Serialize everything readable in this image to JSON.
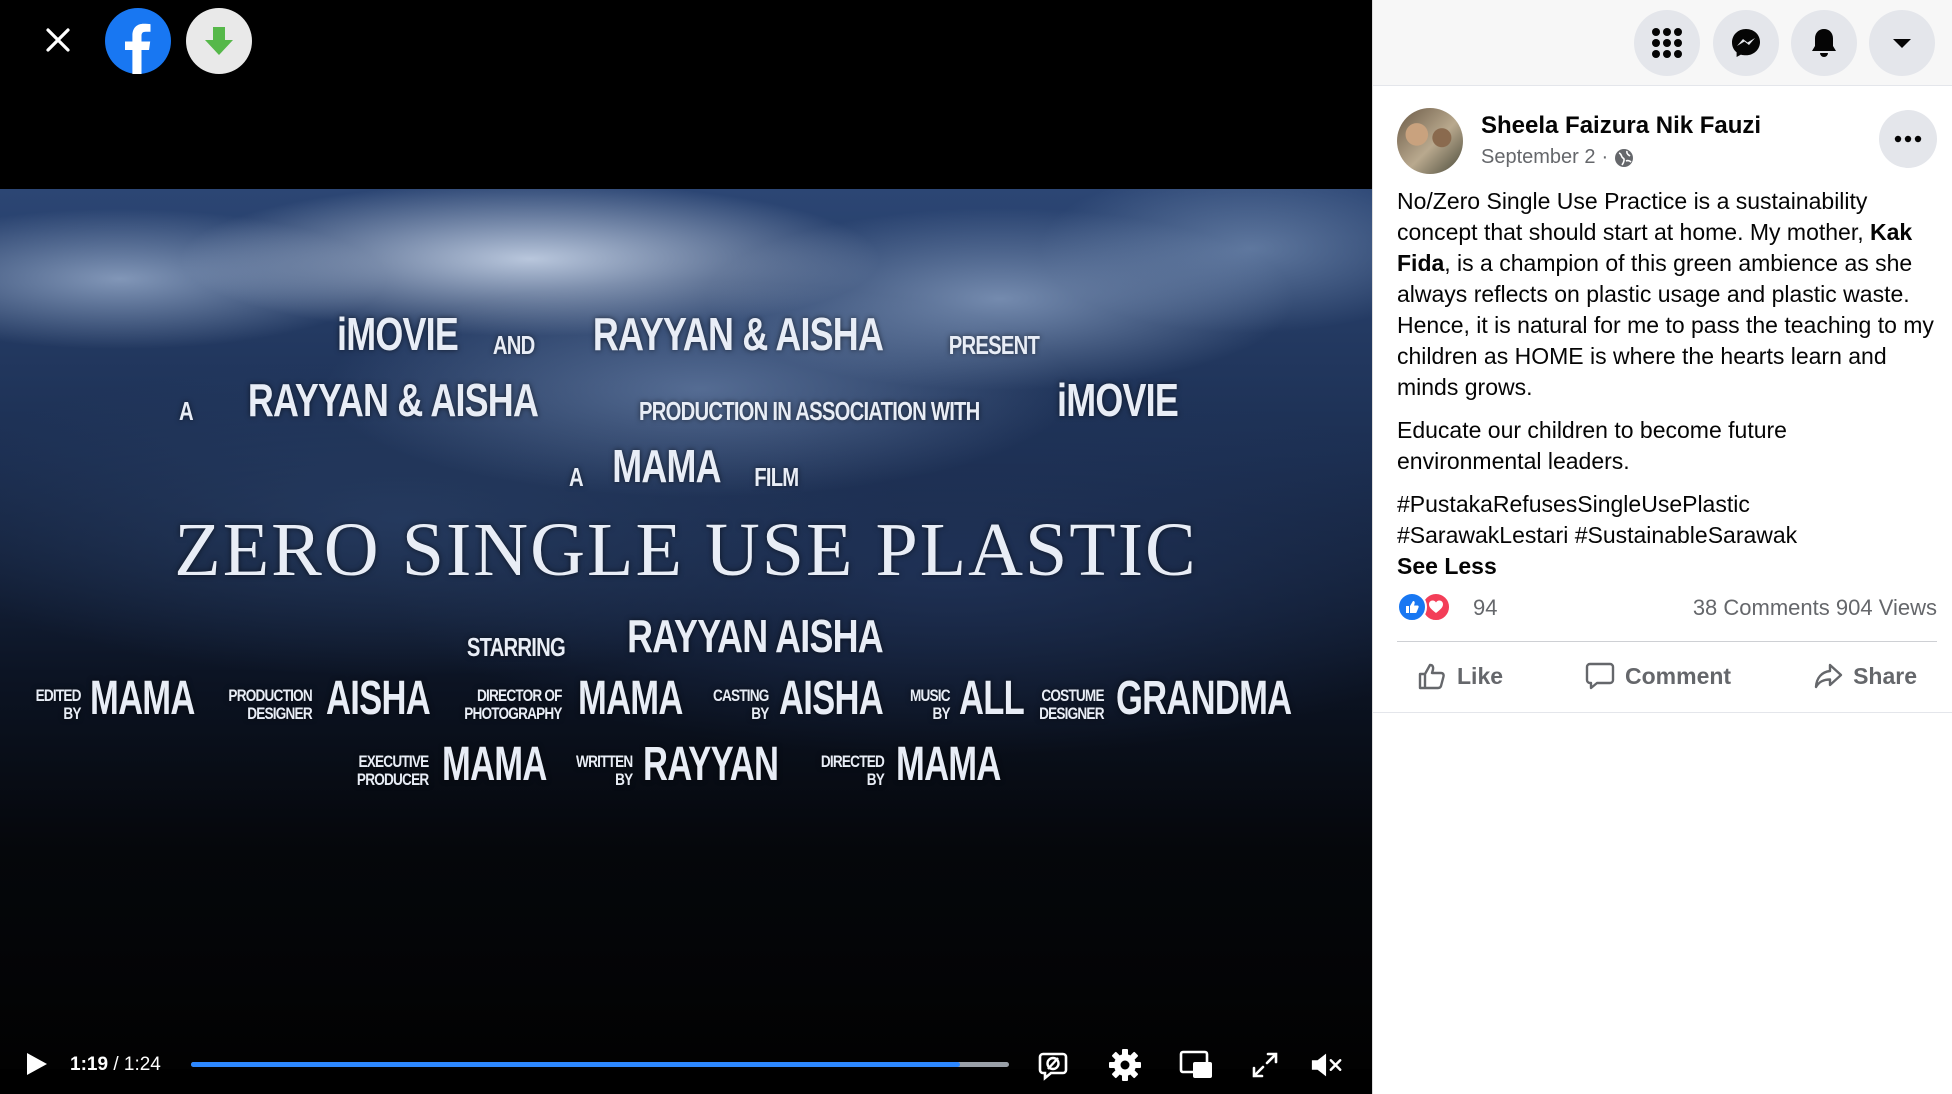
{
  "colors": {
    "facebook_blue": "#1877f2",
    "progress_fill": "#2d88ff",
    "download_green": "#56b84a"
  },
  "video": {
    "credits": {
      "line1": [
        "iMOVIE",
        "AND",
        "RAYYAN & AISHA",
        "PRESENT"
      ],
      "line2": [
        "A",
        "RAYYAN & AISHA",
        "PRODUCTION IN ASSOCIATION WITH",
        "iMOVIE"
      ],
      "line3": [
        "A",
        "MAMA",
        "FILM"
      ],
      "title": "ZERO SINGLE USE PLASTIC",
      "starring_label": "STARRING",
      "starring_names": "RAYYAN  AISHA",
      "roles_row1": [
        {
          "label1": "EDITED",
          "label2": "BY",
          "name": "MAMA"
        },
        {
          "label1": "PRODUCTION",
          "label2": "DESIGNER",
          "name": "AISHA"
        },
        {
          "label1": "DIRECTOR OF",
          "label2": "PHOTOGRAPHY",
          "name": "MAMA"
        },
        {
          "label1": "CASTING",
          "label2": "BY",
          "name": "AISHA"
        },
        {
          "label1": "MUSIC",
          "label2": "BY",
          "name": "ALL"
        },
        {
          "label1": "COSTUME",
          "label2": "DESIGNER",
          "name": "GRANDMA"
        }
      ],
      "roles_row2": [
        {
          "label1": "EXECUTIVE",
          "label2": "PRODUCER",
          "name": "MAMA"
        },
        {
          "label1": "WRITTEN",
          "label2": "BY",
          "name": "RAYYAN"
        },
        {
          "label1": "DIRECTED",
          "label2": "BY",
          "name": "MAMA"
        }
      ]
    },
    "current_time": "1:19",
    "separator": "/",
    "total_time": "1:24",
    "progress_fraction": 0.94
  },
  "post": {
    "author": "Sheela Faizura Nik Fauzi",
    "date": "September 2",
    "date_separator": "·",
    "body_p1_a": "No/Zero Single Use Practice is a sustainability concept that should start at home. My mother, ",
    "body_p1_bold": "Kak Fida",
    "body_p1_b": ", is a champion of this green ambience as she always reflects on plastic usage and plastic waste. Hence, it is natural for me to pass the teaching to my children as HOME is where the hearts learn and minds grows.",
    "body_p2": "Educate our children to become future environmental leaders.",
    "hashtags_line1": "#PustakaRefusesSingleUsePlastic",
    "hashtags_line2": "#SarawakLestari #SustainableSarawak",
    "see_less": "See Less",
    "reaction_count": "94",
    "comments": "38 Comments",
    "views": "904 Views",
    "actions": {
      "like": "Like",
      "comment": "Comment",
      "share": "Share"
    }
  }
}
